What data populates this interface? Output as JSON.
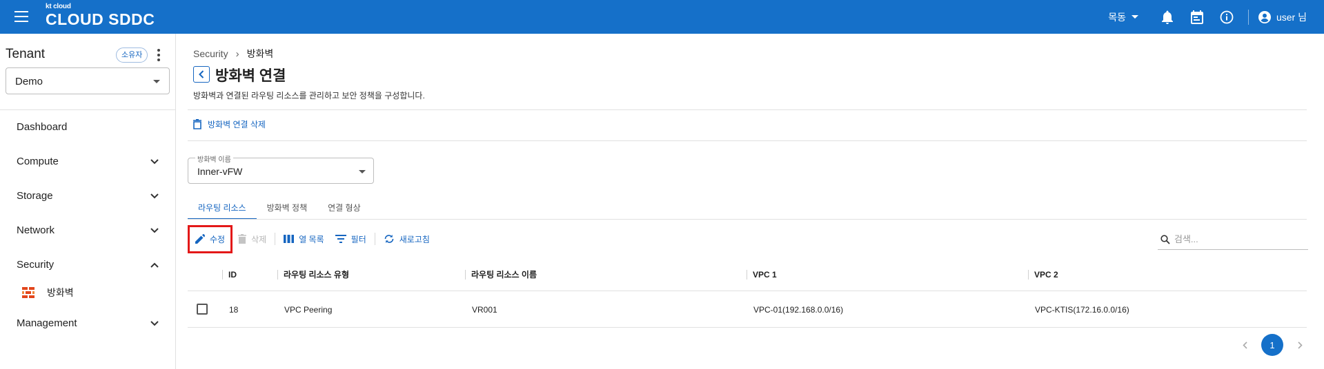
{
  "header": {
    "brand_small": "kt cloud",
    "brand_main": "CLOUD SDDC",
    "region": "목동",
    "user": "user 님",
    "bg_color": "#1570c9"
  },
  "sidebar": {
    "tenant_title": "Tenant",
    "owner_badge": "소유자",
    "tenant_value": "Demo",
    "items": [
      {
        "label": "Dashboard",
        "expandable": false
      },
      {
        "label": "Compute",
        "expandable": true,
        "expanded": false
      },
      {
        "label": "Storage",
        "expandable": true,
        "expanded": false
      },
      {
        "label": "Network",
        "expandable": true,
        "expanded": false
      },
      {
        "label": "Security",
        "expandable": true,
        "expanded": true
      },
      {
        "label": "Management",
        "expandable": true,
        "expanded": false
      }
    ],
    "subitems": [
      {
        "label": "방화벽",
        "icon": "firewall-brick-icon"
      }
    ]
  },
  "breadcrumb": {
    "parent": "Security",
    "separator": "›",
    "current": "방화벽"
  },
  "page": {
    "title": "방화벽 연결",
    "description": "방화벽과 연결된 라우팅 리소스를 관리하고 보안 정책을 구성합니다.",
    "delete_link": "방화벽 연결 삭제"
  },
  "firewall_field": {
    "label": "방화벽 이름",
    "value": "Inner-vFW"
  },
  "tabs": [
    {
      "label": "라우팅 리소스",
      "active": true
    },
    {
      "label": "방화벽 정책",
      "active": false
    },
    {
      "label": "연결 형상",
      "active": false
    }
  ],
  "toolbar": {
    "edit": "수정",
    "delete": "삭제",
    "columns": "열 목록",
    "filter": "필터",
    "refresh": "새로고침"
  },
  "search": {
    "placeholder": "검색..."
  },
  "table": {
    "headers": [
      "ID",
      "라우팅 리소스 유형",
      "라우팅 리소스 이름",
      "VPC 1",
      "VPC 2"
    ],
    "rows": [
      {
        "id": "18",
        "type": "VPC Peering",
        "name": "VR001",
        "vpc1": "VPC-01(192.168.0.0/16)",
        "vpc2": "VPC-KTIS(172.16.0.0/16)",
        "checked": false
      }
    ]
  },
  "pagination": {
    "current_page": "1"
  }
}
